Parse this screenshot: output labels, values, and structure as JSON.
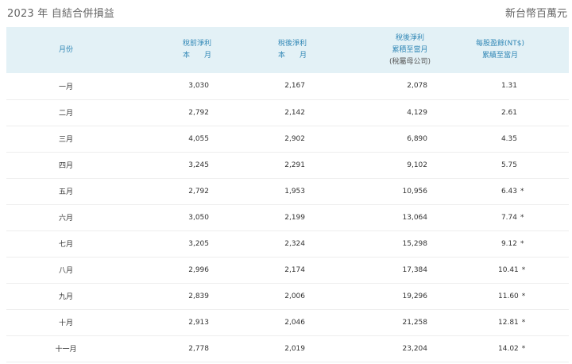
{
  "header": {
    "title": "2023 年 自結合併損益",
    "unit": "新台幣百萬元"
  },
  "columns": {
    "month": "月份",
    "pretax": [
      "稅前淨利",
      "本",
      "月"
    ],
    "aftertax": [
      "稅後淨利",
      "本",
      "月"
    ],
    "cumulative": [
      "稅後淨利",
      "累積至當月",
      "(稅屬母公司)"
    ],
    "eps": [
      "每股盈餘(NT$)",
      "累績至當月"
    ]
  },
  "rows": [
    {
      "month": "一月",
      "pretax": "3,030",
      "aftertax": "2,167",
      "cumulative": "2,078",
      "eps": "1.31",
      "star": ""
    },
    {
      "month": "二月",
      "pretax": "2,792",
      "aftertax": "2,142",
      "cumulative": "4,129",
      "eps": "2.61",
      "star": ""
    },
    {
      "month": "三月",
      "pretax": "4,055",
      "aftertax": "2,902",
      "cumulative": "6,890",
      "eps": "4.35",
      "star": ""
    },
    {
      "month": "四月",
      "pretax": "3,245",
      "aftertax": "2,291",
      "cumulative": "9,102",
      "eps": "5.75",
      "star": ""
    },
    {
      "month": "五月",
      "pretax": "2,792",
      "aftertax": "1,953",
      "cumulative": "10,956",
      "eps": "6.43",
      "star": "*"
    },
    {
      "month": "六月",
      "pretax": "3,050",
      "aftertax": "2,199",
      "cumulative": "13,064",
      "eps": "7.74",
      "star": "*"
    },
    {
      "month": "七月",
      "pretax": "3,205",
      "aftertax": "2,324",
      "cumulative": "15,298",
      "eps": "9.12",
      "star": "*"
    },
    {
      "month": "八月",
      "pretax": "2,996",
      "aftertax": "2,174",
      "cumulative": "17,384",
      "eps": "10.41",
      "star": "*"
    },
    {
      "month": "九月",
      "pretax": "2,839",
      "aftertax": "2,006",
      "cumulative": "19,296",
      "eps": "11.60",
      "star": "*"
    },
    {
      "month": "十月",
      "pretax": "2,913",
      "aftertax": "2,046",
      "cumulative": "21,258",
      "eps": "12.81",
      "star": "*"
    },
    {
      "month": "十一月",
      "pretax": "2,778",
      "aftertax": "2,019",
      "cumulative": "23,204",
      "eps": "14.02",
      "star": "*"
    }
  ]
}
